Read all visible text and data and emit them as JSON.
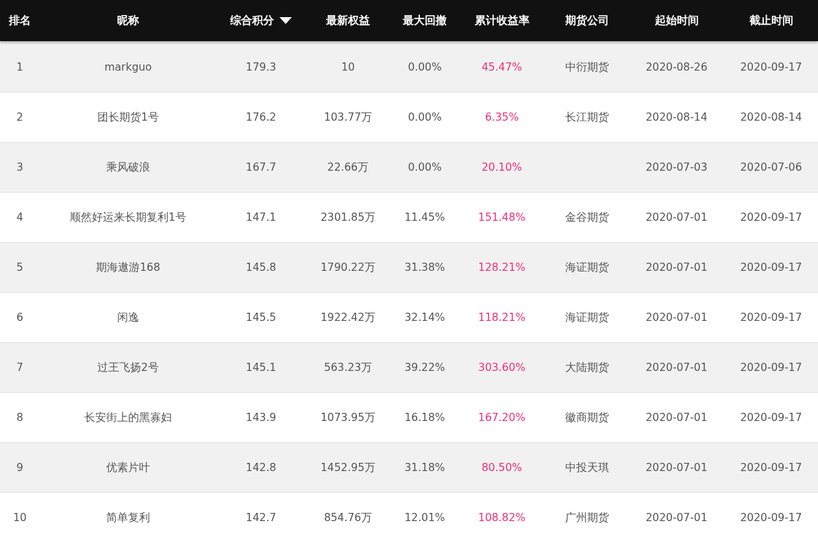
{
  "table": {
    "columns": [
      {
        "label": "排名",
        "sorted": false
      },
      {
        "label": "昵称",
        "sorted": false
      },
      {
        "label": "综合积分",
        "sorted": true
      },
      {
        "label": "最新权益",
        "sorted": false
      },
      {
        "label": "最大回撤",
        "sorted": false
      },
      {
        "label": "累计收益率",
        "sorted": false
      },
      {
        "label": "期货公司",
        "sorted": false
      },
      {
        "label": "起始时间",
        "sorted": false
      },
      {
        "label": "截止时间",
        "sorted": false
      }
    ],
    "rows": [
      {
        "rank": "1",
        "nickname": "markguo",
        "score": "179.3",
        "equity": "10",
        "drawdown": "0.00%",
        "return": "45.47%",
        "company": "中衍期货",
        "start": "2020-08-26",
        "end": "2020-09-17"
      },
      {
        "rank": "2",
        "nickname": "团长期货1号",
        "score": "176.2",
        "equity": "103.77万",
        "drawdown": "0.00%",
        "return": "6.35%",
        "company": "长江期货",
        "start": "2020-08-14",
        "end": "2020-08-14"
      },
      {
        "rank": "3",
        "nickname": "乘风破浪",
        "score": "167.7",
        "equity": "22.66万",
        "drawdown": "0.00%",
        "return": "20.10%",
        "start": "2020-07-03",
        "end": "2020-07-06"
      },
      {
        "rank": "4",
        "nickname": "顺然好运来长期复利1号",
        "score": "147.1",
        "equity": "2301.85万",
        "drawdown": "11.45%",
        "return": "151.48%",
        "company": "金谷期货",
        "start": "2020-07-01",
        "end": "2020-09-17"
      },
      {
        "rank": "5",
        "nickname": "期海遨游168",
        "score": "145.8",
        "equity": "1790.22万",
        "drawdown": "31.38%",
        "return": "128.21%",
        "company": "海证期货",
        "start": "2020-07-01",
        "end": "2020-09-17"
      },
      {
        "rank": "6",
        "nickname": "闲逸",
        "score": "145.5",
        "equity": "1922.42万",
        "drawdown": "32.14%",
        "return": "118.21%",
        "company": "海证期货",
        "start": "2020-07-01",
        "end": "2020-09-17"
      },
      {
        "rank": "7",
        "nickname": "过王飞扬2号",
        "score": "145.1",
        "equity": "563.23万",
        "drawdown": "39.22%",
        "return": "303.60%",
        "company": "大陆期货",
        "start": "2020-07-01",
        "end": "2020-09-17"
      },
      {
        "rank": "8",
        "nickname": "长安街上的黑寡妇",
        "score": "143.9",
        "equity": "1073.95万",
        "drawdown": "16.18%",
        "return": "167.20%",
        "company": "徽商期货",
        "start": "2020-07-01",
        "end": "2020-09-17"
      },
      {
        "rank": "9",
        "nickname": "优素片叶",
        "score": "142.8",
        "equity": "1452.95万",
        "drawdown": "31.18%",
        "return": "80.50%",
        "company": "中投天琪",
        "start": "2020-07-01",
        "end": "2020-09-17"
      },
      {
        "rank": "10",
        "nickname": "简单复利",
        "score": "142.7",
        "equity": "854.76万",
        "drawdown": "12.01%",
        "return": "108.82%",
        "company": "广州期货",
        "start": "2020-07-01",
        "end": "2020-09-17"
      }
    ]
  }
}
